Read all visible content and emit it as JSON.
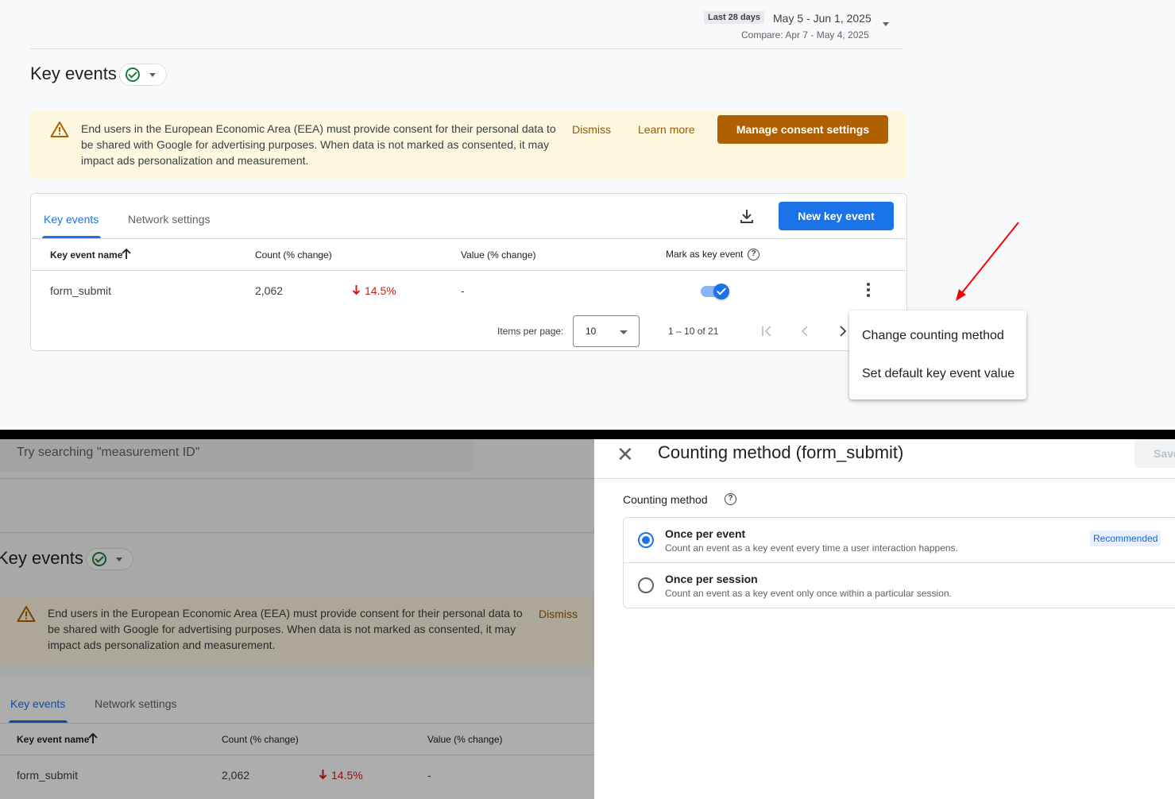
{
  "date_header": {
    "chip": "Last 28 days",
    "range": "May 5 - Jun 1, 2025",
    "compare": "Compare: Apr 7 - May 4, 2025"
  },
  "page_title": "Key events",
  "banner": {
    "text": "End users in the European Economic Area (EEA) must provide consent for their personal data to be shared with Google for advertising purposes. When data is not marked as consented, it may impact ads personalization and measurement.",
    "dismiss": "Dismiss",
    "learn_more": "Learn more",
    "manage": "Manage consent settings"
  },
  "tabs": {
    "key_events": "Key events",
    "network_settings": "Network settings"
  },
  "new_key_event": "New key event",
  "table": {
    "headers": {
      "name": "Key event name",
      "count": "Count (% change)",
      "value": "Value (% change)",
      "mark": "Mark as key event"
    },
    "row": {
      "name": "form_submit",
      "count": "2,062",
      "change": "14.5%",
      "value": "-",
      "is_key_event": true
    }
  },
  "pagination": {
    "items_label": "Items per page:",
    "items_value": "10",
    "range": "1 – 10 of 21"
  },
  "menu": {
    "change_counting": "Change counting method",
    "set_default": "Set default key event value"
  },
  "bottom": {
    "search_placeholder": "Try searching \"measurement ID\"",
    "panel_title": "Counting method (form_submit)",
    "save": "Save",
    "counting_label": "Counting method",
    "options": [
      {
        "title": "Once per event",
        "desc": "Count an event as a key event every time a user interaction happens.",
        "selected": true,
        "badge": "Recommended"
      },
      {
        "title": "Once per session",
        "desc": "Count an event as a key event only once within a particular session.",
        "selected": false
      }
    ]
  },
  "colors": {
    "primary": "#1a73e8",
    "warning_bg": "#fef7e0",
    "warning_btn": "#b06000",
    "negative": "#c5221f",
    "annotation_arrow": "#ff0000"
  }
}
